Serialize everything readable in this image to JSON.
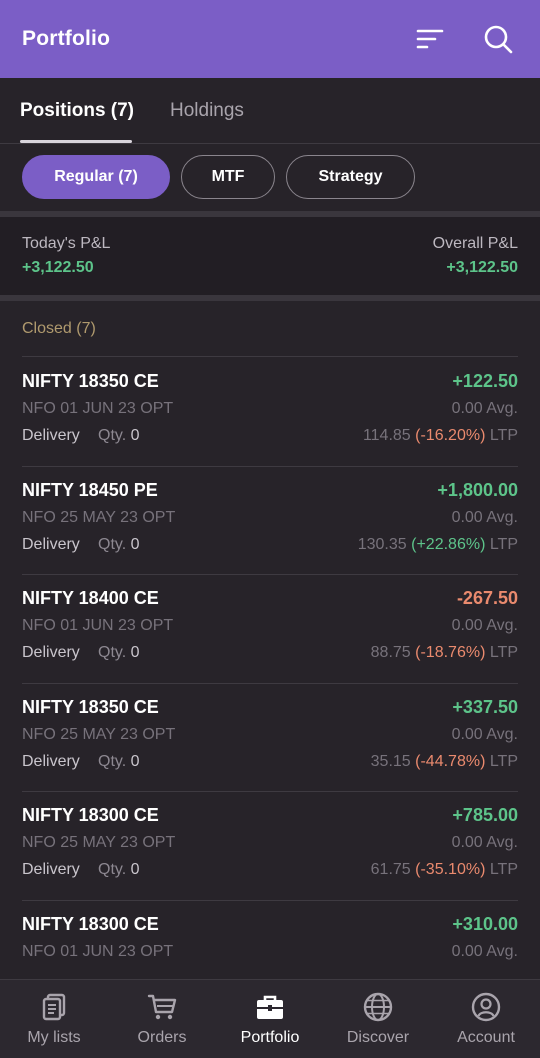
{
  "header": {
    "title": "Portfolio",
    "filter_icon": "filter-icon",
    "search_icon": "search-icon"
  },
  "tabs": [
    {
      "label": "Positions (7)"
    },
    {
      "label": "Holdings"
    }
  ],
  "chips": [
    {
      "label": "Regular (7)"
    },
    {
      "label": "MTF"
    },
    {
      "label": "Strategy"
    }
  ],
  "pnl": {
    "today_label": "Today's P&L",
    "today_value": "+3,122.50",
    "overall_label": "Overall P&L",
    "overall_value": "+3,122.50"
  },
  "section": {
    "label": "Closed (7)"
  },
  "positions": [
    {
      "symbol": "NIFTY 18350 CE",
      "pl": "+122.50",
      "pl_sign": "pos",
      "exchange": "NFO 01 JUN 23 OPT",
      "avg": "0.00 Avg.",
      "product": "Delivery",
      "qty_label": "Qty.",
      "qty": "0",
      "ltp": "114.85",
      "change": "(-16.20%)",
      "change_sign": "neg",
      "ltp_label": "LTP"
    },
    {
      "symbol": "NIFTY 18450 PE",
      "pl": "+1,800.00",
      "pl_sign": "pos",
      "exchange": "NFO 25 MAY 23 OPT",
      "avg": "0.00 Avg.",
      "product": "Delivery",
      "qty_label": "Qty.",
      "qty": "0",
      "ltp": "130.35",
      "change": "(+22.86%)",
      "change_sign": "pos",
      "ltp_label": "LTP"
    },
    {
      "symbol": "NIFTY 18400 CE",
      "pl": "-267.50",
      "pl_sign": "neg",
      "exchange": "NFO 01 JUN 23 OPT",
      "avg": "0.00 Avg.",
      "product": "Delivery",
      "qty_label": "Qty.",
      "qty": "0",
      "ltp": "88.75",
      "change": "(-18.76%)",
      "change_sign": "neg",
      "ltp_label": "LTP"
    },
    {
      "symbol": "NIFTY 18350 CE",
      "pl": "+337.50",
      "pl_sign": "pos",
      "exchange": "NFO 25 MAY 23 OPT",
      "avg": "0.00 Avg.",
      "product": "Delivery",
      "qty_label": "Qty.",
      "qty": "0",
      "ltp": "35.15",
      "change": "(-44.78%)",
      "change_sign": "neg",
      "ltp_label": "LTP"
    },
    {
      "symbol": "NIFTY 18300 CE",
      "pl": "+785.00",
      "pl_sign": "pos",
      "exchange": "NFO 25 MAY 23 OPT",
      "avg": "0.00 Avg.",
      "product": "Delivery",
      "qty_label": "Qty.",
      "qty": "0",
      "ltp": "61.75",
      "change": "(-35.10%)",
      "change_sign": "neg",
      "ltp_label": "LTP"
    },
    {
      "symbol": "NIFTY 18300 CE",
      "pl": "+310.00",
      "pl_sign": "pos",
      "exchange": "NFO 01 JUN 23 OPT",
      "avg": "0.00 Avg.",
      "product": "",
      "qty_label": "",
      "qty": "",
      "ltp": "",
      "change": "",
      "change_sign": "neg",
      "ltp_label": ""
    }
  ],
  "colors": {
    "accent": "#7b5ec6",
    "positive": "#5dc48a",
    "negative": "#ea8a6e",
    "background": "#272329"
  },
  "bottom_nav": [
    {
      "label": "My lists",
      "icon": "lists-icon"
    },
    {
      "label": "Orders",
      "icon": "cart-icon"
    },
    {
      "label": "Portfolio",
      "icon": "briefcase-icon",
      "active": true
    },
    {
      "label": "Discover",
      "icon": "globe-icon"
    },
    {
      "label": "Account",
      "icon": "user-icon"
    }
  ]
}
